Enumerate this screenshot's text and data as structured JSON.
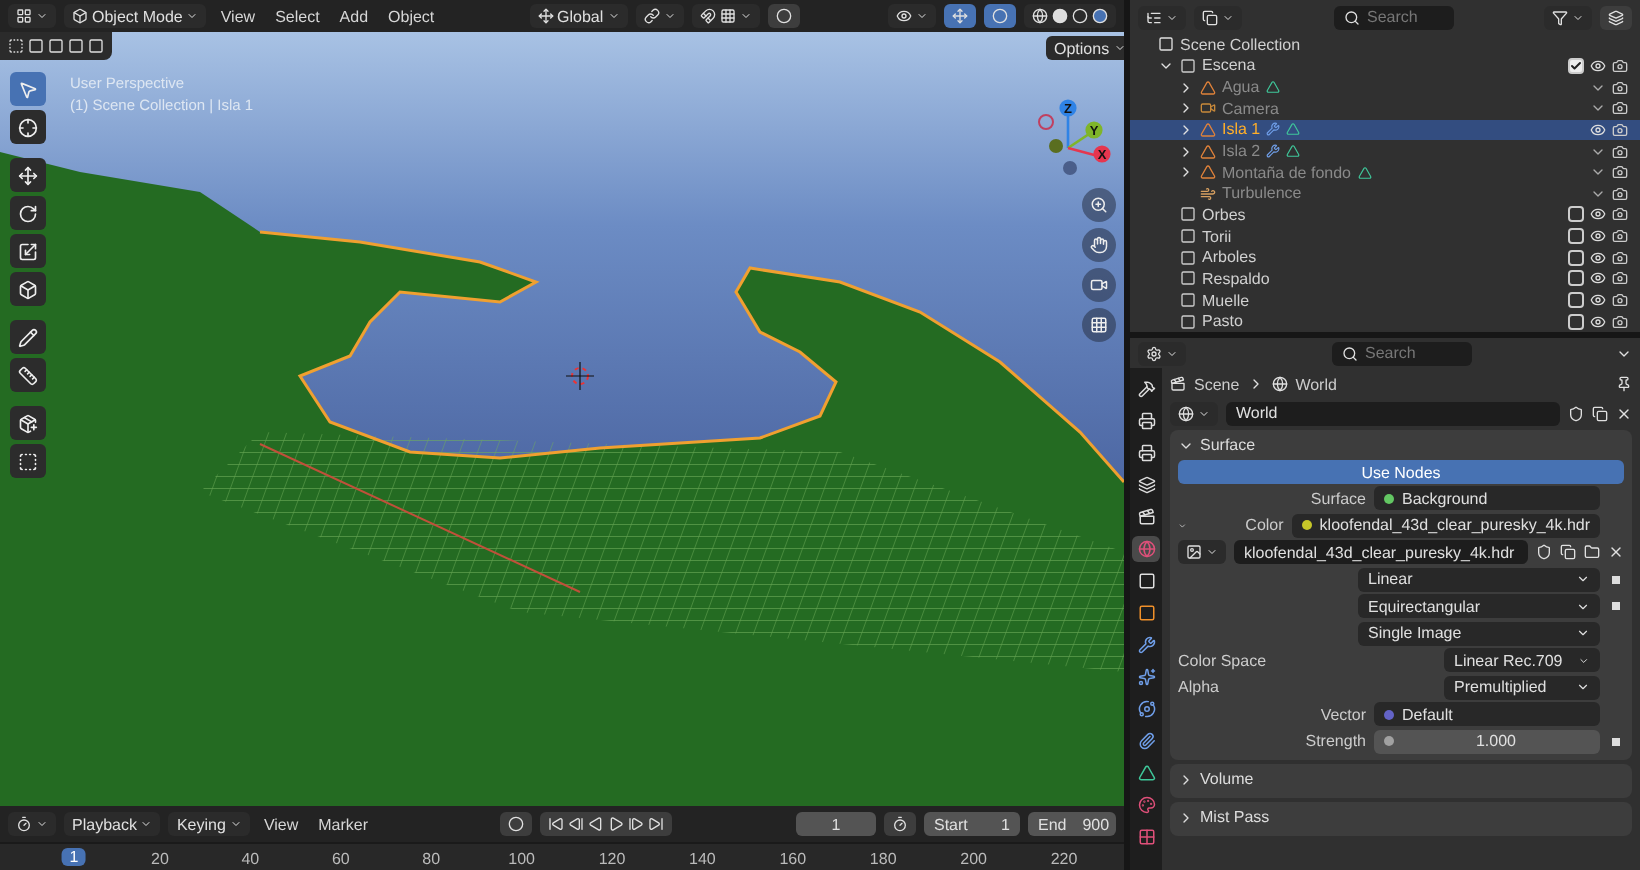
{
  "viewport": {
    "mode": "Object Mode",
    "menus": [
      "View",
      "Select",
      "Add",
      "Object"
    ],
    "orientation": "Global",
    "options": "Options",
    "overlay_text": [
      "User Perspective",
      "(1) Scene Collection | Isla 1"
    ],
    "tools": [
      {
        "kind": "select",
        "selected": true
      },
      {
        "kind": "cursor",
        "selected": false
      },
      {
        "kind": "move",
        "selected": false
      },
      {
        "kind": "rotate",
        "selected": false
      },
      {
        "kind": "scale",
        "selected": false
      },
      {
        "kind": "transform",
        "selected": false
      },
      {
        "kind": "annotate",
        "selected": false
      },
      {
        "kind": "measure",
        "selected": false
      },
      {
        "kind": "add",
        "selected": false
      },
      {
        "kind": "cube",
        "selected": false
      }
    ],
    "axes": [
      {
        "label": "Z",
        "color": "#2f83e6"
      },
      {
        "label": "Y",
        "color": "#7fb52a"
      },
      {
        "label": "X",
        "color": "#e6364f"
      }
    ]
  },
  "timeline": {
    "menus": [
      {
        "label": "Playback",
        "dropdown": true
      },
      {
        "label": "Keying",
        "dropdown": true
      },
      {
        "label": "View",
        "dropdown": false
      },
      {
        "label": "Marker",
        "dropdown": false
      }
    ],
    "current_frame": "1",
    "start_label": "Start",
    "start": "1",
    "end_label": "End",
    "end": "900",
    "current_marker": "1",
    "ruler": [
      "20",
      "40",
      "60",
      "80",
      "100",
      "120",
      "140",
      "160",
      "180",
      "200",
      "220"
    ]
  },
  "outliner": {
    "search": {
      "placeholder": "Search"
    },
    "root": "Scene Collection",
    "items": [
      {
        "name": "Escena",
        "kind": "collection",
        "expanded": true,
        "checked": true,
        "visible": true,
        "selected": false,
        "children": [
          {
            "name": "Agua",
            "kind": "mesh",
            "expanded": false,
            "visible": false,
            "modifier": false,
            "selected": false
          },
          {
            "name": "Camera",
            "kind": "camera",
            "expanded": false,
            "visible": false,
            "modifier": false,
            "selected": false
          },
          {
            "name": "Isla 1",
            "kind": "mesh",
            "expanded": false,
            "visible": true,
            "modifier": true,
            "selected": true
          },
          {
            "name": "Isla 2",
            "kind": "mesh",
            "expanded": false,
            "visible": false,
            "modifier": true,
            "selected": false
          },
          {
            "name": "Montaña de fondo",
            "kind": "mesh",
            "expanded": false,
            "visible": false,
            "modifier": false,
            "selected": false
          },
          {
            "name": "Turbulence",
            "kind": "force",
            "visible": false,
            "modifier": false,
            "selected": false
          }
        ]
      },
      {
        "name": "Orbes",
        "kind": "collection",
        "checked": false,
        "visible": true,
        "selected": false
      },
      {
        "name": "Torii",
        "kind": "collection",
        "checked": false,
        "visible": true,
        "selected": false
      },
      {
        "name": "Arboles",
        "kind": "collection",
        "checked": false,
        "visible": true,
        "selected": false
      },
      {
        "name": "Respaldo",
        "kind": "collection",
        "checked": false,
        "visible": true,
        "selected": false
      },
      {
        "name": "Muelle",
        "kind": "collection",
        "checked": false,
        "visible": true,
        "selected": false
      },
      {
        "name": "Pasto",
        "kind": "collection",
        "checked": false,
        "visible": true,
        "selected": false
      }
    ]
  },
  "properties": {
    "search": {
      "placeholder": "Search"
    },
    "breadcrumb": [
      "Scene",
      "World"
    ],
    "datablock": "World",
    "tabs": [
      {
        "kind": "tool",
        "selected": false
      },
      {
        "kind": "render",
        "selected": false
      },
      {
        "kind": "output",
        "selected": false
      },
      {
        "kind": "view_layer",
        "selected": false
      },
      {
        "kind": "scene",
        "selected": false
      },
      {
        "kind": "world",
        "selected": true
      },
      {
        "kind": "collection",
        "selected": false
      },
      {
        "kind": "object",
        "selected": false
      },
      {
        "kind": "modifier",
        "selected": false
      },
      {
        "kind": "particles",
        "selected": false
      },
      {
        "kind": "physics",
        "selected": false
      },
      {
        "kind": "constraints",
        "selected": false
      },
      {
        "kind": "data",
        "selected": false
      },
      {
        "kind": "material",
        "selected": false
      },
      {
        "kind": "texture",
        "selected": false
      }
    ],
    "surface": {
      "title": "Surface",
      "expanded": true,
      "use_nodes": "Use Nodes",
      "rows": [
        {
          "kind": "socket",
          "label": "Surface",
          "value": "Background",
          "color": "#63c763"
        },
        {
          "kind": "socket",
          "label": "Color",
          "value": "kloofendal_43d_clear_puresky_4k.hdr",
          "color": "#c7c729",
          "expanded": true
        },
        {
          "kind": "image",
          "value": "kloofendal_43d_clear_puresky_4k.hdr"
        },
        {
          "kind": "dropdown",
          "value": "Linear",
          "keyframe": true
        },
        {
          "kind": "dropdown",
          "value": "Equirectangular",
          "keyframe": true
        },
        {
          "kind": "dropdown",
          "value": "Single Image",
          "keyframe": false
        },
        {
          "kind": "enum",
          "label": "Color Space",
          "value": "Linear Rec.709"
        },
        {
          "kind": "enum",
          "label": "Alpha",
          "value": "Premultiplied"
        },
        {
          "kind": "socket",
          "label": "Vector",
          "value": "Default",
          "color": "#6363c7"
        },
        {
          "kind": "number",
          "label": "Strength",
          "value": "1.000",
          "color": "#a1a1a1"
        }
      ]
    },
    "panels": [
      {
        "title": "Volume",
        "expanded": false
      },
      {
        "title": "Mist Pass",
        "expanded": false
      }
    ]
  }
}
